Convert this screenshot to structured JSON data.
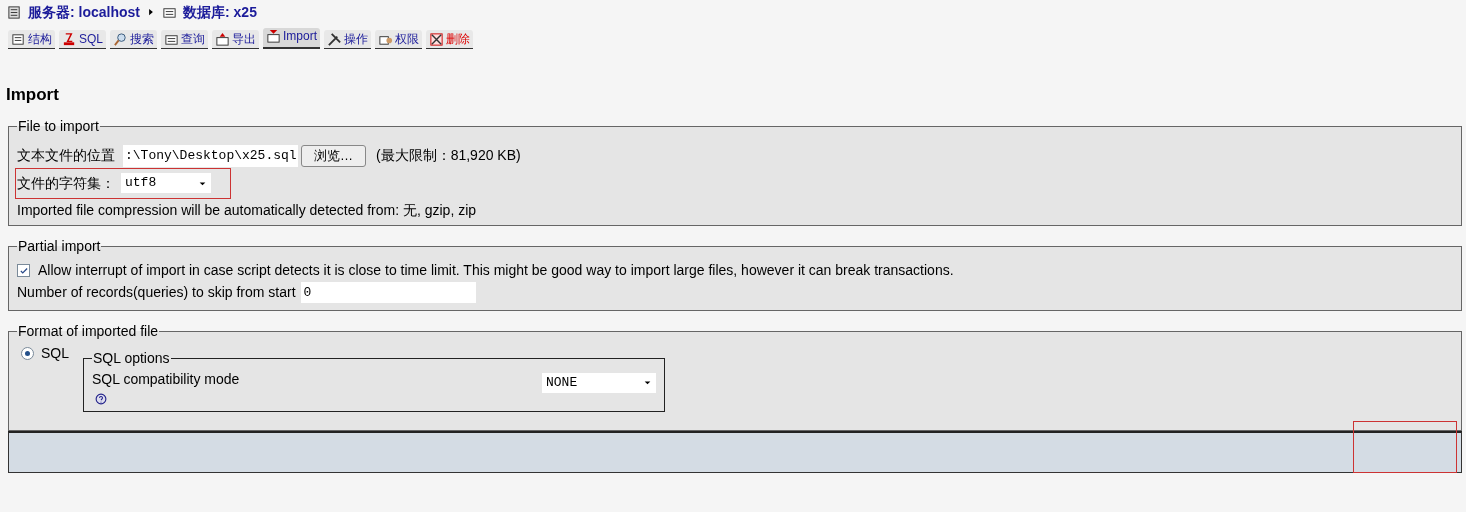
{
  "breadcrumb": [
    {
      "label": "服务器: localhost"
    },
    {
      "label": "数据库: x25"
    }
  ],
  "tabs": [
    {
      "label": "结构",
      "selected": false,
      "kind": "normal"
    },
    {
      "label": "SQL",
      "selected": false,
      "kind": "normal"
    },
    {
      "label": "搜索",
      "selected": false,
      "kind": "normal"
    },
    {
      "label": "查询",
      "selected": false,
      "kind": "normal"
    },
    {
      "label": "导出",
      "selected": false,
      "kind": "normal"
    },
    {
      "label": "Import",
      "selected": true,
      "kind": "normal"
    },
    {
      "label": "操作",
      "selected": false,
      "kind": "normal"
    },
    {
      "label": "权限",
      "selected": false,
      "kind": "normal"
    },
    {
      "label": "删除",
      "selected": false,
      "kind": "danger"
    }
  ],
  "heading": "Import",
  "file_section": {
    "legend": "File to import",
    "location_label": "文本文件的位置",
    "file_value": ":\\Tony\\Desktop\\x25.sql",
    "browse_button": "浏览…",
    "limit": "(最大限制：81,920 KB)",
    "charset_label": "文件的字符集：",
    "charset_value": "utf8",
    "compression_note": "Imported file compression will be automatically detected from: 无, gzip, zip"
  },
  "partial_section": {
    "legend": "Partial import",
    "allow_interrupt": {
      "label": "Allow interrupt of import in case script detects it is close to time limit. This might be good way to import large files, however it can break transactions.",
      "checked": true
    },
    "skip_label": "Number of records(queries) to skip from start",
    "skip_value": "0"
  },
  "format_section": {
    "legend": "Format of imported file",
    "formats": [
      {
        "label": "SQL",
        "selected": true
      }
    ],
    "options_legend": "SQL options",
    "compat_label": "SQL compatibility mode",
    "compat_value": "NONE"
  }
}
